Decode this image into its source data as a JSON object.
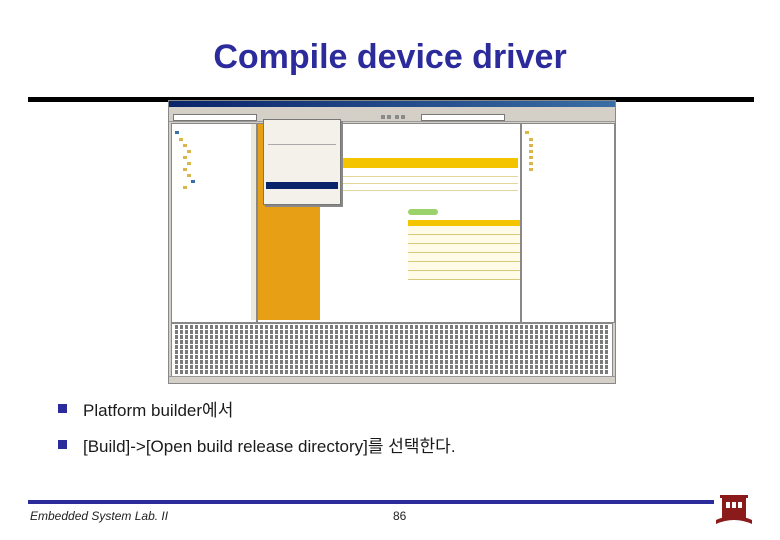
{
  "slide": {
    "title": "Compile device driver",
    "bullets": [
      "Platform builder에서",
      "[Build]->[Open build release directory]를 선택한다."
    ],
    "footer": "Embedded System Lab. II",
    "page_number": "86"
  },
  "colors": {
    "title": "#2b2b9c",
    "bullet": "#2b2b9c",
    "footer_rule": "#2b2b9c"
  },
  "screenshot": {
    "window_icons": [
      "minimize-icon",
      "maximize-icon",
      "close-icon"
    ]
  }
}
